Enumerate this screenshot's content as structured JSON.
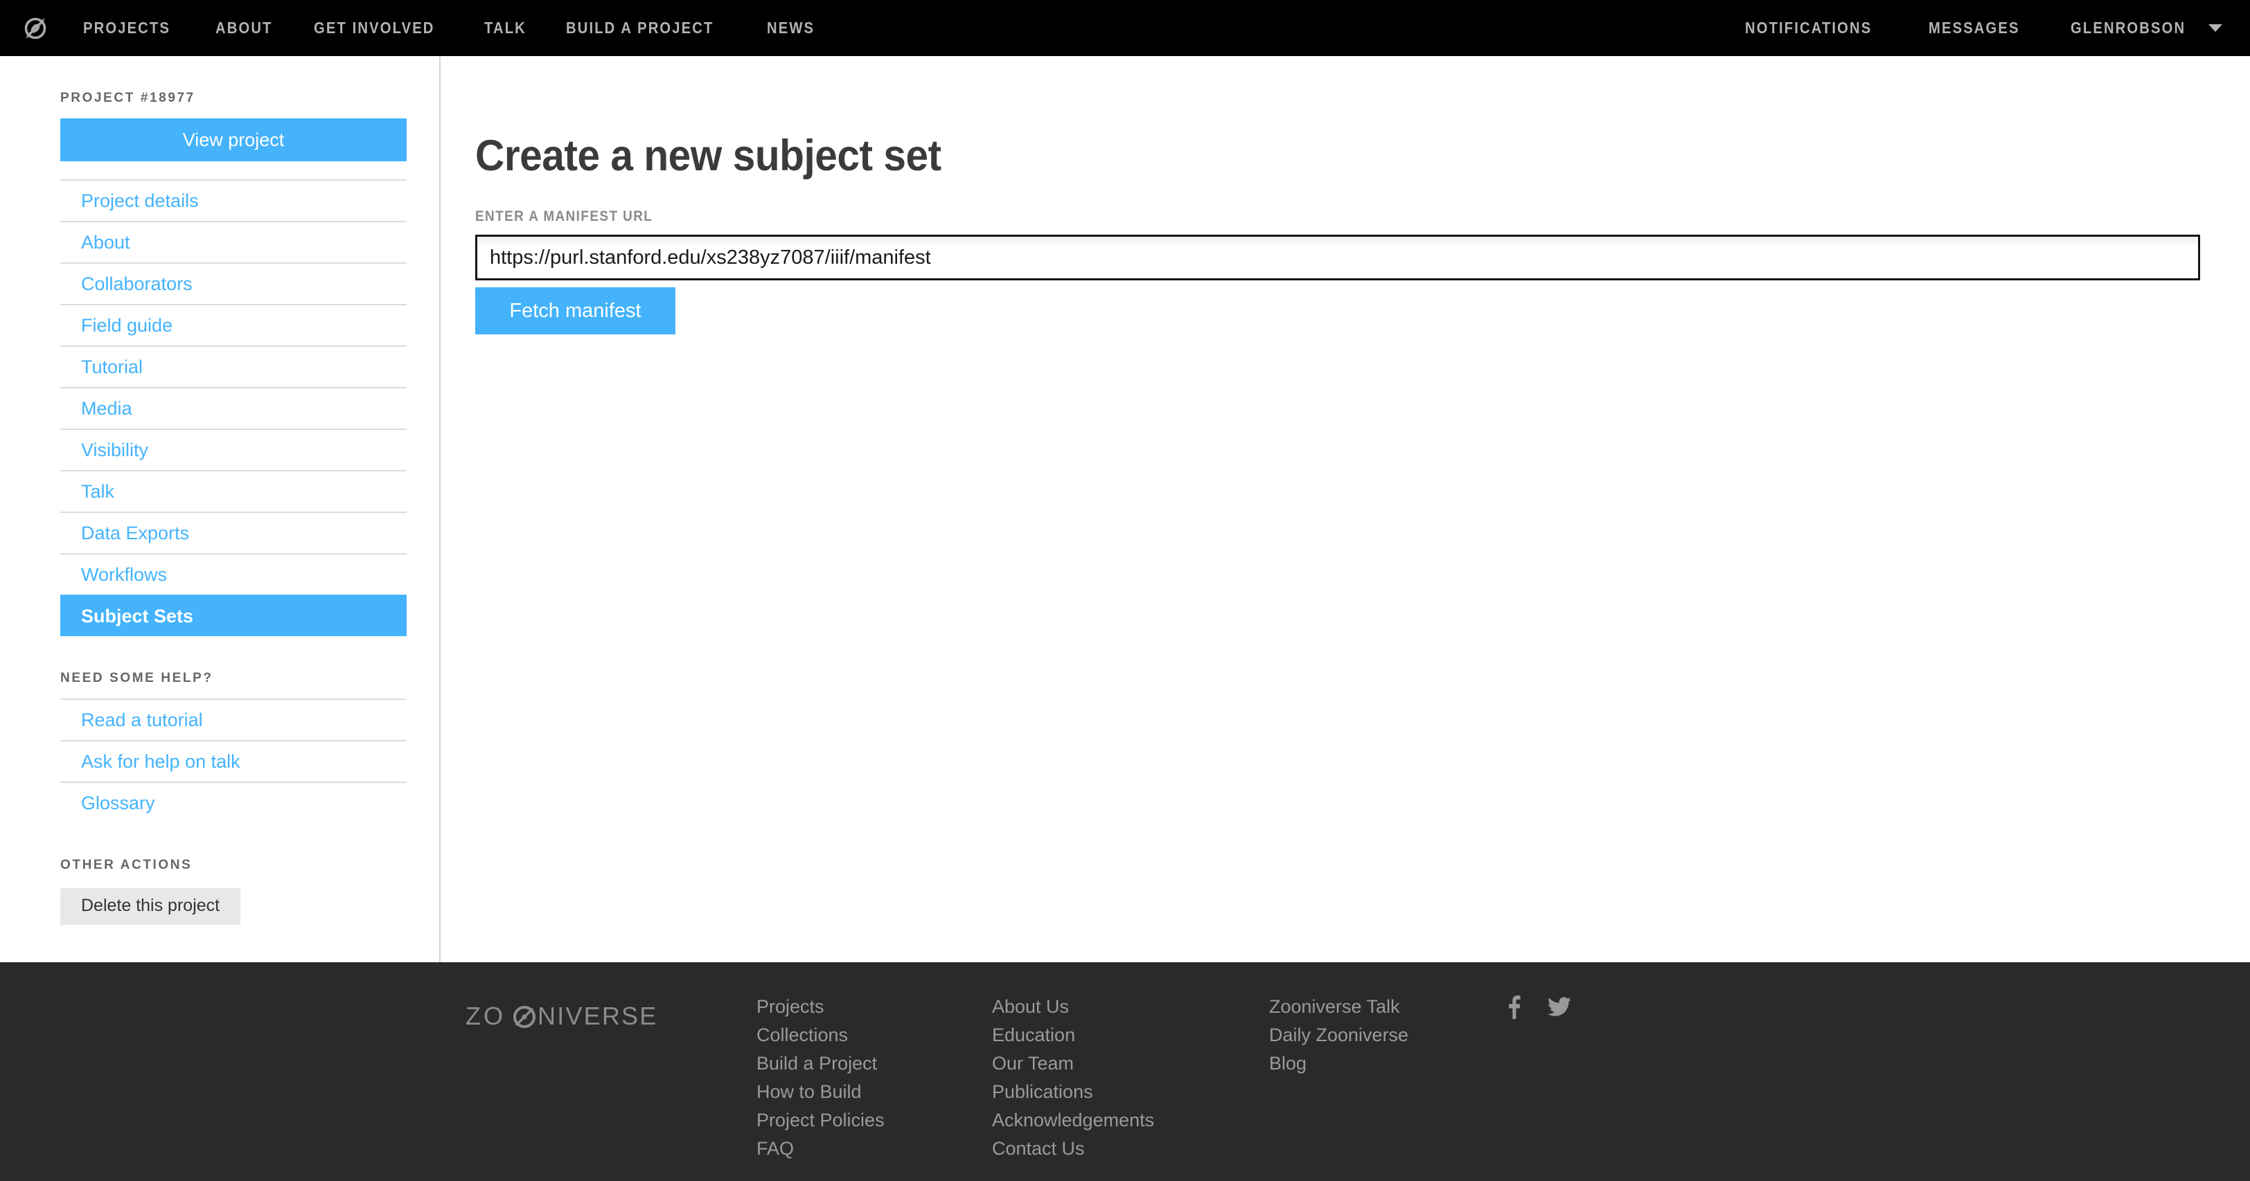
{
  "topnav": {
    "logo_icon": "zooniverse-logo-icon",
    "left_links": [
      "PROJECTS",
      "ABOUT",
      "GET INVOLVED",
      "TALK",
      "BUILD A PROJECT",
      "NEWS"
    ],
    "right_links": [
      "NOTIFICATIONS",
      "MESSAGES"
    ],
    "user": "GLENROBSON",
    "user_caret_icon": "chevron-down-icon"
  },
  "sidebar": {
    "project_caption": "PROJECT #18977",
    "view_project_label": "View project",
    "nav_items": [
      {
        "label": "Project details",
        "active": false
      },
      {
        "label": "About",
        "active": false
      },
      {
        "label": "Collaborators",
        "active": false
      },
      {
        "label": "Field guide",
        "active": false
      },
      {
        "label": "Tutorial",
        "active": false
      },
      {
        "label": "Media",
        "active": false
      },
      {
        "label": "Visibility",
        "active": false
      },
      {
        "label": "Talk",
        "active": false
      },
      {
        "label": "Data Exports",
        "active": false
      },
      {
        "label": "Workflows",
        "active": false
      },
      {
        "label": "Subject Sets",
        "active": true
      }
    ],
    "help_caption": "NEED SOME HELP?",
    "help_items": [
      "Read a tutorial",
      "Ask for help on talk",
      "Glossary"
    ],
    "other_caption": "OTHER ACTIONS",
    "delete_label": "Delete this project"
  },
  "main": {
    "title": "Create a new subject set",
    "manifest_label": "ENTER A MANIFEST URL",
    "manifest_value": "https://purl.stanford.edu/xs238yz7087/iiif/manifest",
    "manifest_placeholder": "",
    "fetch_label": "Fetch manifest"
  },
  "footer": {
    "wordmark": "ZOONIVERSE",
    "col1": [
      "Projects",
      "Collections",
      "Build a Project",
      "How to Build",
      "Project Policies",
      "FAQ"
    ],
    "col2": [
      "About Us",
      "Education",
      "Our Team",
      "Publications",
      "Acknowledgements",
      "Contact Us"
    ],
    "col3": [
      "Zooniverse Talk",
      "Daily Zooniverse",
      "Blog"
    ],
    "social": [
      "facebook-icon",
      "twitter-icon"
    ]
  },
  "colors": {
    "accent_blue": "#44b3fc",
    "nav_black": "#000000",
    "footer_dark": "#2a2a2a",
    "nav_text_gray": "#b3b3b3",
    "footer_text_gray": "#9a9a9a",
    "title_gray": "#3b3b3b",
    "delete_bg": "#e8e8e8"
  }
}
